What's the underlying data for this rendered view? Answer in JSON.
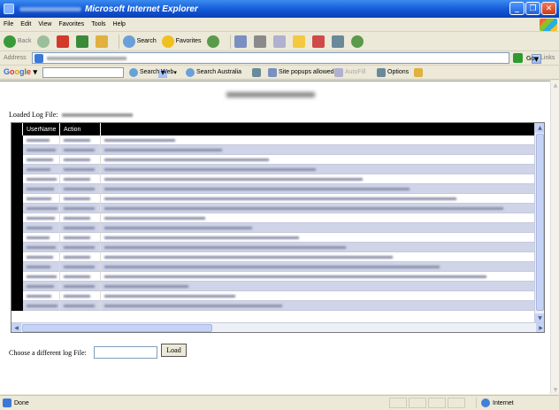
{
  "window": {
    "title": "Microsoft Internet Explorer"
  },
  "menu": [
    "File",
    "Edit",
    "View",
    "Favorites",
    "Tools",
    "Help"
  ],
  "toolbar": {
    "back": "Back",
    "search": "Search",
    "favorites": "Favorites"
  },
  "address": {
    "label": "Address",
    "go": "Go",
    "links": "Links"
  },
  "google": {
    "search_web": "Search Web",
    "search_australia": "Search Australia",
    "popups": "Site popups allowed",
    "autofill": "AutoFill",
    "options": "Options"
  },
  "page": {
    "loaded_log_label": "Loaded Log File:",
    "columns": [
      "UserName",
      "Action"
    ],
    "row_count": 18,
    "choose_label": "Choose a different log File:",
    "load_button": "Load"
  },
  "status": {
    "text": "Done",
    "zone": "Internet"
  }
}
